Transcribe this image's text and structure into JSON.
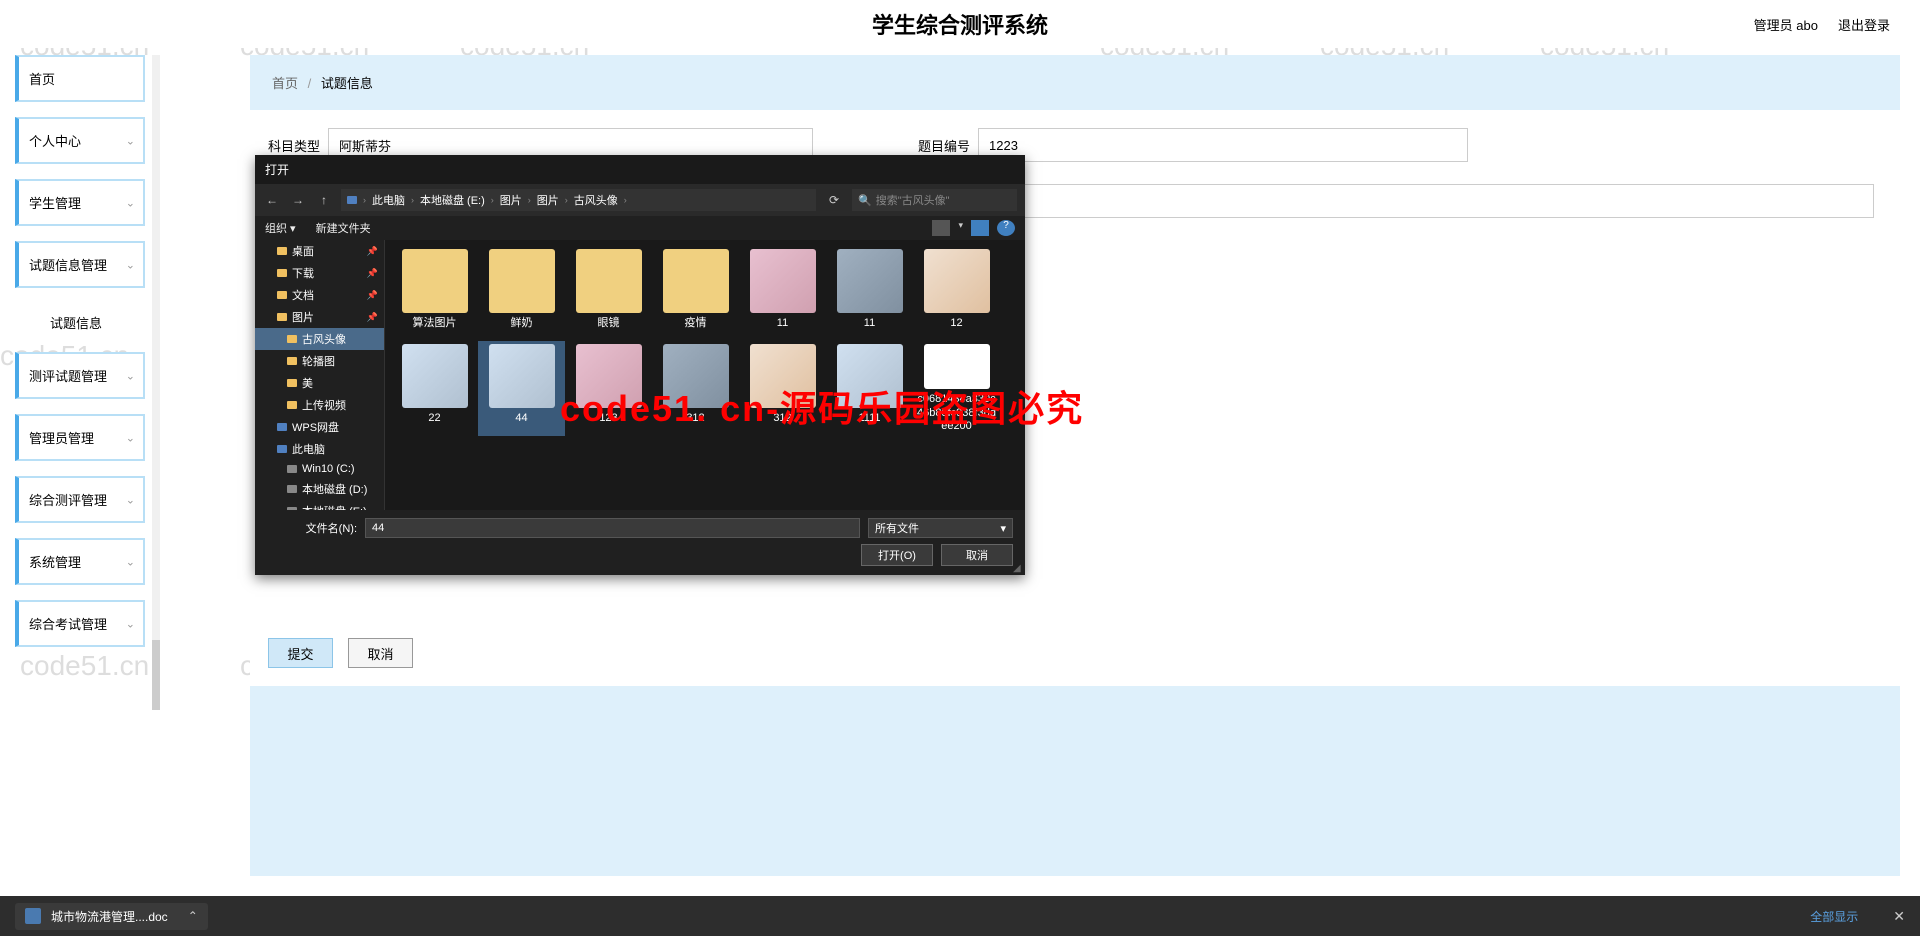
{
  "header": {
    "title": "学生综合测评系统",
    "admin_label": "管理员 abo",
    "logout_label": "退出登录"
  },
  "sidebar": {
    "items": [
      {
        "label": "首页",
        "hasChevron": false
      },
      {
        "label": "个人中心",
        "hasChevron": true
      },
      {
        "label": "学生管理",
        "hasChevron": true
      },
      {
        "label": "试题信息管理",
        "hasChevron": true
      },
      {
        "label": "试题信息",
        "hasChevron": false,
        "sub": true
      },
      {
        "label": "测评试题管理",
        "hasChevron": true
      },
      {
        "label": "管理员管理",
        "hasChevron": true
      },
      {
        "label": "综合测评管理",
        "hasChevron": true
      },
      {
        "label": "系统管理",
        "hasChevron": true
      },
      {
        "label": "综合考试管理",
        "hasChevron": true
      }
    ]
  },
  "breadcrumb": {
    "home": "首页",
    "current": "试题信息"
  },
  "form": {
    "label_subject": "科目类型",
    "value_subject": "阿斯蒂芬",
    "label_number": "题目编号",
    "value_number": "1223",
    "btn_submit": "提交",
    "btn_cancel": "取消"
  },
  "file_dialog": {
    "title": "打开",
    "crumbs": [
      "此电脑",
      "本地磁盘 (E:)",
      "图片",
      "图片",
      "古风头像"
    ],
    "search_placeholder": "搜索\"古风头像\"",
    "organize": "组织",
    "new_folder": "新建文件夹",
    "tree": [
      {
        "label": "桌面",
        "type": "folder",
        "pin": true
      },
      {
        "label": "下载",
        "type": "folder",
        "pin": true
      },
      {
        "label": "文档",
        "type": "folder",
        "pin": true
      },
      {
        "label": "图片",
        "type": "folder",
        "pin": true
      },
      {
        "label": "古风头像",
        "type": "folder",
        "sub": true,
        "selected": true
      },
      {
        "label": "轮播图",
        "type": "folder",
        "sub": true
      },
      {
        "label": "美",
        "type": "folder",
        "sub": true
      },
      {
        "label": "上传视频",
        "type": "folder",
        "sub": true
      },
      {
        "label": "WPS网盘",
        "type": "cloud"
      },
      {
        "label": "此电脑",
        "type": "pc"
      },
      {
        "label": "Win10 (C:)",
        "type": "disk",
        "sub": true
      },
      {
        "label": "本地磁盘 (D:)",
        "type": "disk",
        "sub": true
      },
      {
        "label": "本地磁盘 (E:)",
        "type": "disk",
        "sub": true
      }
    ],
    "files": [
      {
        "name": "算法图片",
        "type": "folder"
      },
      {
        "name": "鲜奶",
        "type": "folder"
      },
      {
        "name": "眼镜",
        "type": "folder"
      },
      {
        "name": "疫情",
        "type": "folder"
      },
      {
        "name": "11",
        "type": "img"
      },
      {
        "name": "11",
        "type": "img2"
      },
      {
        "name": "12",
        "type": "img3"
      },
      {
        "name": "22",
        "type": "img4"
      },
      {
        "name": "44",
        "type": "img4",
        "selected": true
      },
      {
        "name": "123",
        "type": "img"
      },
      {
        "name": "312",
        "type": "img2"
      },
      {
        "name": "312",
        "type": "img3"
      },
      {
        "name": "1111",
        "type": "img4"
      },
      {
        "name": "c0681434a330c46b85fc938f3ddee200",
        "type": "doc"
      }
    ],
    "filename_label": "文件名(N):",
    "filename_value": "44",
    "filter_label": "所有文件",
    "btn_open": "打开(O)",
    "btn_cancel": "取消"
  },
  "download_bar": {
    "filename": "城市物流港管理....doc",
    "show_all": "全部显示"
  },
  "watermark": "code51.cn",
  "watermark_red": "code51. cn-源码乐园盗图必究"
}
